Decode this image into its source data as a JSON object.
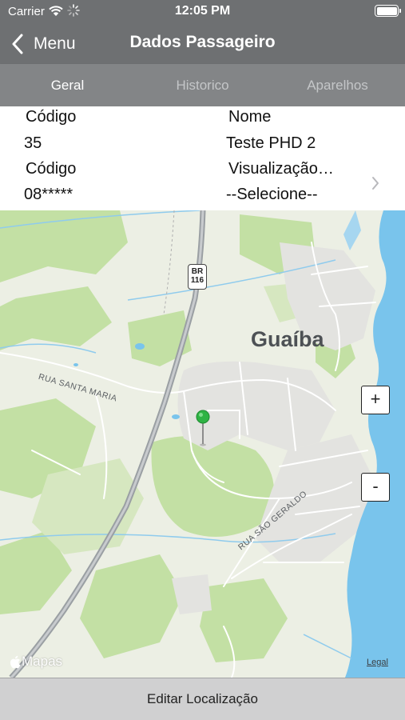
{
  "status_bar": {
    "carrier": "Carrier",
    "time": "12:05 PM",
    "icons": [
      "wifi-icon",
      "activity-spinner-icon",
      "battery-icon"
    ]
  },
  "nav": {
    "back_label": "Menu",
    "back_icon": "chevron-left-icon",
    "title": "Dados Passageiro",
    "bar_color": "#6e7072"
  },
  "tabs": {
    "items": [
      {
        "label": "Geral",
        "active": true
      },
      {
        "label": "Historico",
        "active": false
      },
      {
        "label": "Aparelhos",
        "active": false
      }
    ],
    "bar_color": "#838587"
  },
  "info": {
    "codigo_label": "Código",
    "codigo_value": "35",
    "nome_label": "Nome",
    "nome_value": "Teste PHD 2",
    "codigo2_label": "Código",
    "codigo2_value": "08*****",
    "visualizacao_label": "Visualização…",
    "visualizacao_value": "--Selecione--",
    "chevron_icon": "chevron-right-icon"
  },
  "map": {
    "city_label": "Guaíba",
    "road_label_1": "RUA SANTA MARIA",
    "road_label_2": "RUA SÃO GERALDO",
    "highway_shield": {
      "line1": "BR",
      "line2": "116"
    },
    "zoom_in": "+",
    "zoom_out": "-",
    "attribution": "Mapas",
    "attribution_icon": "apple-logo-icon",
    "legal": "Legal",
    "pin_icon": "map-pin-icon",
    "pin_color": "#2fb344",
    "water_color": "#79c4ec",
    "land_color": "#ecefe4",
    "forest_color": "#c3e0a4"
  },
  "footer": {
    "edit_button": "Editar Localização"
  }
}
